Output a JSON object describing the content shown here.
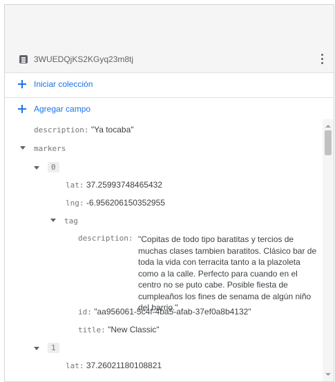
{
  "document": {
    "id": "3WUEDQjKS2KGyq23m8tj"
  },
  "actions": {
    "start_collection": "Iniciar colección",
    "add_field": "Agregar campo"
  },
  "fields": {
    "description_key": "description:",
    "description_val": "\"Ya tocaba\"",
    "markers_key": "markers",
    "item0_index": "0",
    "lat_key": "lat:",
    "lat0_val": "37.25993748465432",
    "lng_key": "lng:",
    "lng0_val": "-6.956206150352955",
    "tag_key": "tag",
    "tag_description_key": "description:",
    "tag_description_val": "\"Copitas de todo tipo baratitas y tercios de muchas clases tambien baratitos. Clásico bar de toda la vida con terracita tanto a la plazoleta como a la calle. Perfecto para cuando en el centro no se puto cabe. Posible fiesta de cumpleaños los fines de senama de algún niño del barrio.\"",
    "id_key": "id:",
    "id_val": "\"aa956061-5c4f-4ba5-afab-37ef0a8b4132\"",
    "title_key": "title:",
    "title_val": "\"New Classic\"",
    "item1_index": "1",
    "lat1_val": "37.26021180108821"
  },
  "icons": {
    "document": "document-icon",
    "menu": "more-vert-icon",
    "add": "plus-icon",
    "expand": "caret-down-icon"
  },
  "colors": {
    "accent": "#1a73e8",
    "key_text": "#757575",
    "panel_bg": "#f5f5f5"
  }
}
